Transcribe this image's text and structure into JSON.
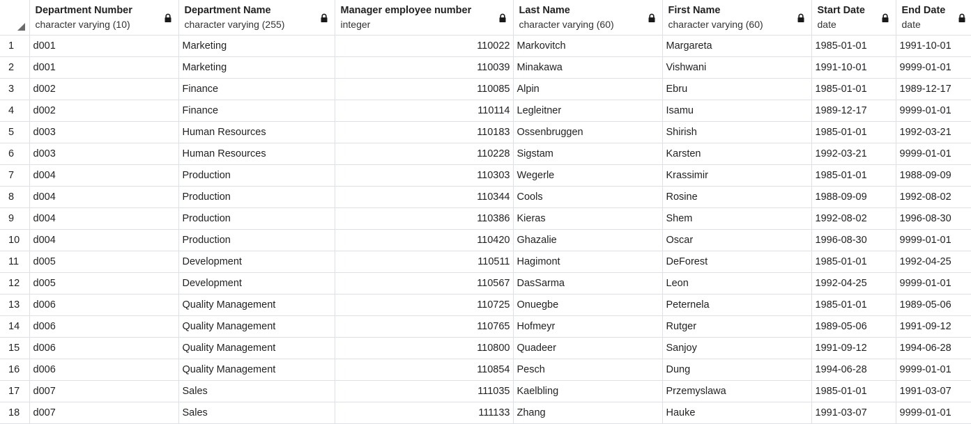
{
  "columns": [
    {
      "name": "Department Number",
      "type": "character varying (10)",
      "icon": "lock-icon"
    },
    {
      "name": "Department Name",
      "type": "character varying (255)",
      "icon": "lock-icon"
    },
    {
      "name": "Manager employee number",
      "type": "integer",
      "icon": "lock-icon"
    },
    {
      "name": "Last Name",
      "type": "character varying (60)",
      "icon": "lock-icon"
    },
    {
      "name": "First Name",
      "type": "character varying (60)",
      "icon": "lock-icon"
    },
    {
      "name": "Start Date",
      "type": "date",
      "icon": "lock-icon"
    },
    {
      "name": "End Date",
      "type": "date",
      "icon": "lock-icon"
    }
  ],
  "rows": [
    {
      "index": "1",
      "cells": [
        "d001",
        "Marketing",
        "110022",
        "Markovitch",
        "Margareta",
        "1985-01-01",
        "1991-10-01"
      ]
    },
    {
      "index": "2",
      "cells": [
        "d001",
        "Marketing",
        "110039",
        "Minakawa",
        "Vishwani",
        "1991-10-01",
        "9999-01-01"
      ]
    },
    {
      "index": "3",
      "cells": [
        "d002",
        "Finance",
        "110085",
        "Alpin",
        "Ebru",
        "1985-01-01",
        "1989-12-17"
      ]
    },
    {
      "index": "4",
      "cells": [
        "d002",
        "Finance",
        "110114",
        "Legleitner",
        "Isamu",
        "1989-12-17",
        "9999-01-01"
      ]
    },
    {
      "index": "5",
      "cells": [
        "d003",
        "Human Resources",
        "110183",
        "Ossenbruggen",
        "Shirish",
        "1985-01-01",
        "1992-03-21"
      ]
    },
    {
      "index": "6",
      "cells": [
        "d003",
        "Human Resources",
        "110228",
        "Sigstam",
        "Karsten",
        "1992-03-21",
        "9999-01-01"
      ]
    },
    {
      "index": "7",
      "cells": [
        "d004",
        "Production",
        "110303",
        "Wegerle",
        "Krassimir",
        "1985-01-01",
        "1988-09-09"
      ]
    },
    {
      "index": "8",
      "cells": [
        "d004",
        "Production",
        "110344",
        "Cools",
        "Rosine",
        "1988-09-09",
        "1992-08-02"
      ]
    },
    {
      "index": "9",
      "cells": [
        "d004",
        "Production",
        "110386",
        "Kieras",
        "Shem",
        "1992-08-02",
        "1996-08-30"
      ]
    },
    {
      "index": "10",
      "cells": [
        "d004",
        "Production",
        "110420",
        "Ghazalie",
        "Oscar",
        "1996-08-30",
        "9999-01-01"
      ]
    },
    {
      "index": "11",
      "cells": [
        "d005",
        "Development",
        "110511",
        "Hagimont",
        "DeForest",
        "1985-01-01",
        "1992-04-25"
      ]
    },
    {
      "index": "12",
      "cells": [
        "d005",
        "Development",
        "110567",
        "DasSarma",
        "Leon",
        "1992-04-25",
        "9999-01-01"
      ]
    },
    {
      "index": "13",
      "cells": [
        "d006",
        "Quality Management",
        "110725",
        "Onuegbe",
        "Peternela",
        "1985-01-01",
        "1989-05-06"
      ]
    },
    {
      "index": "14",
      "cells": [
        "d006",
        "Quality Management",
        "110765",
        "Hofmeyr",
        "Rutger",
        "1989-05-06",
        "1991-09-12"
      ]
    },
    {
      "index": "15",
      "cells": [
        "d006",
        "Quality Management",
        "110800",
        "Quadeer",
        "Sanjoy",
        "1991-09-12",
        "1994-06-28"
      ]
    },
    {
      "index": "16",
      "cells": [
        "d006",
        "Quality Management",
        "110854",
        "Pesch",
        "Dung",
        "1994-06-28",
        "9999-01-01"
      ]
    },
    {
      "index": "17",
      "cells": [
        "d007",
        "Sales",
        "111035",
        "Kaelbling",
        "Przemyslawa",
        "1985-01-01",
        "1991-03-07"
      ]
    },
    {
      "index": "18",
      "cells": [
        "d007",
        "Sales",
        "111133",
        "Zhang",
        "Hauke",
        "1991-03-07",
        "9999-01-01"
      ]
    }
  ]
}
